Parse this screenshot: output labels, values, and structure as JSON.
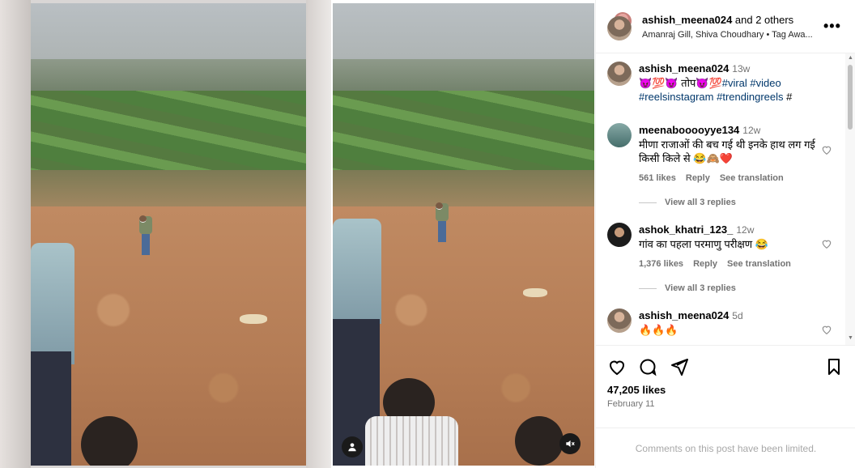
{
  "post": {
    "header": {
      "author": "ashish_meena024",
      "coauthors": " and 2 others",
      "subline": "Amanraj Gill, Shiva Choudhary • Tag Awa...",
      "more_label": "•••"
    },
    "comments": [
      {
        "user": "ashish_meena024",
        "time": "13w",
        "text_prefix": "😈💯😈 तोप😈💯",
        "tags": [
          "#viral",
          "#video",
          "#reelsinstagram",
          "#trendingreels",
          "#"
        ]
      },
      {
        "user": "meenabooooyye134",
        "time": "12w",
        "text": "मीणा राजाओं की बच गई थी इनके हाथ लग गई किसी किले से 😂🙈❤️",
        "likes": "561 likes",
        "reply": "Reply",
        "translate": "See translation",
        "view_replies": "View all 3 replies"
      },
      {
        "user": "ashok_khatri_123_",
        "time": "12w",
        "text": "गांव का पहला परमाणु परीक्षण 😂",
        "likes": "1,376 likes",
        "reply": "Reply",
        "translate": "See translation",
        "view_replies": "View all 3 replies"
      },
      {
        "user": "ashish_meena024",
        "time": "5d",
        "text": "🔥🔥🔥"
      }
    ],
    "likes_count": "47,205 likes",
    "date": "February 11",
    "comments_limited": "Comments on this post have been limited."
  },
  "icons": {
    "like": "heart-icon",
    "comment": "comment-icon",
    "share": "send-icon",
    "save": "bookmark-icon",
    "tagged_user": "user-icon",
    "audio": "muted-speaker-icon"
  },
  "colors": {
    "tag_link": "#00376b",
    "muted_text": "#737373",
    "border": "#efefef"
  }
}
